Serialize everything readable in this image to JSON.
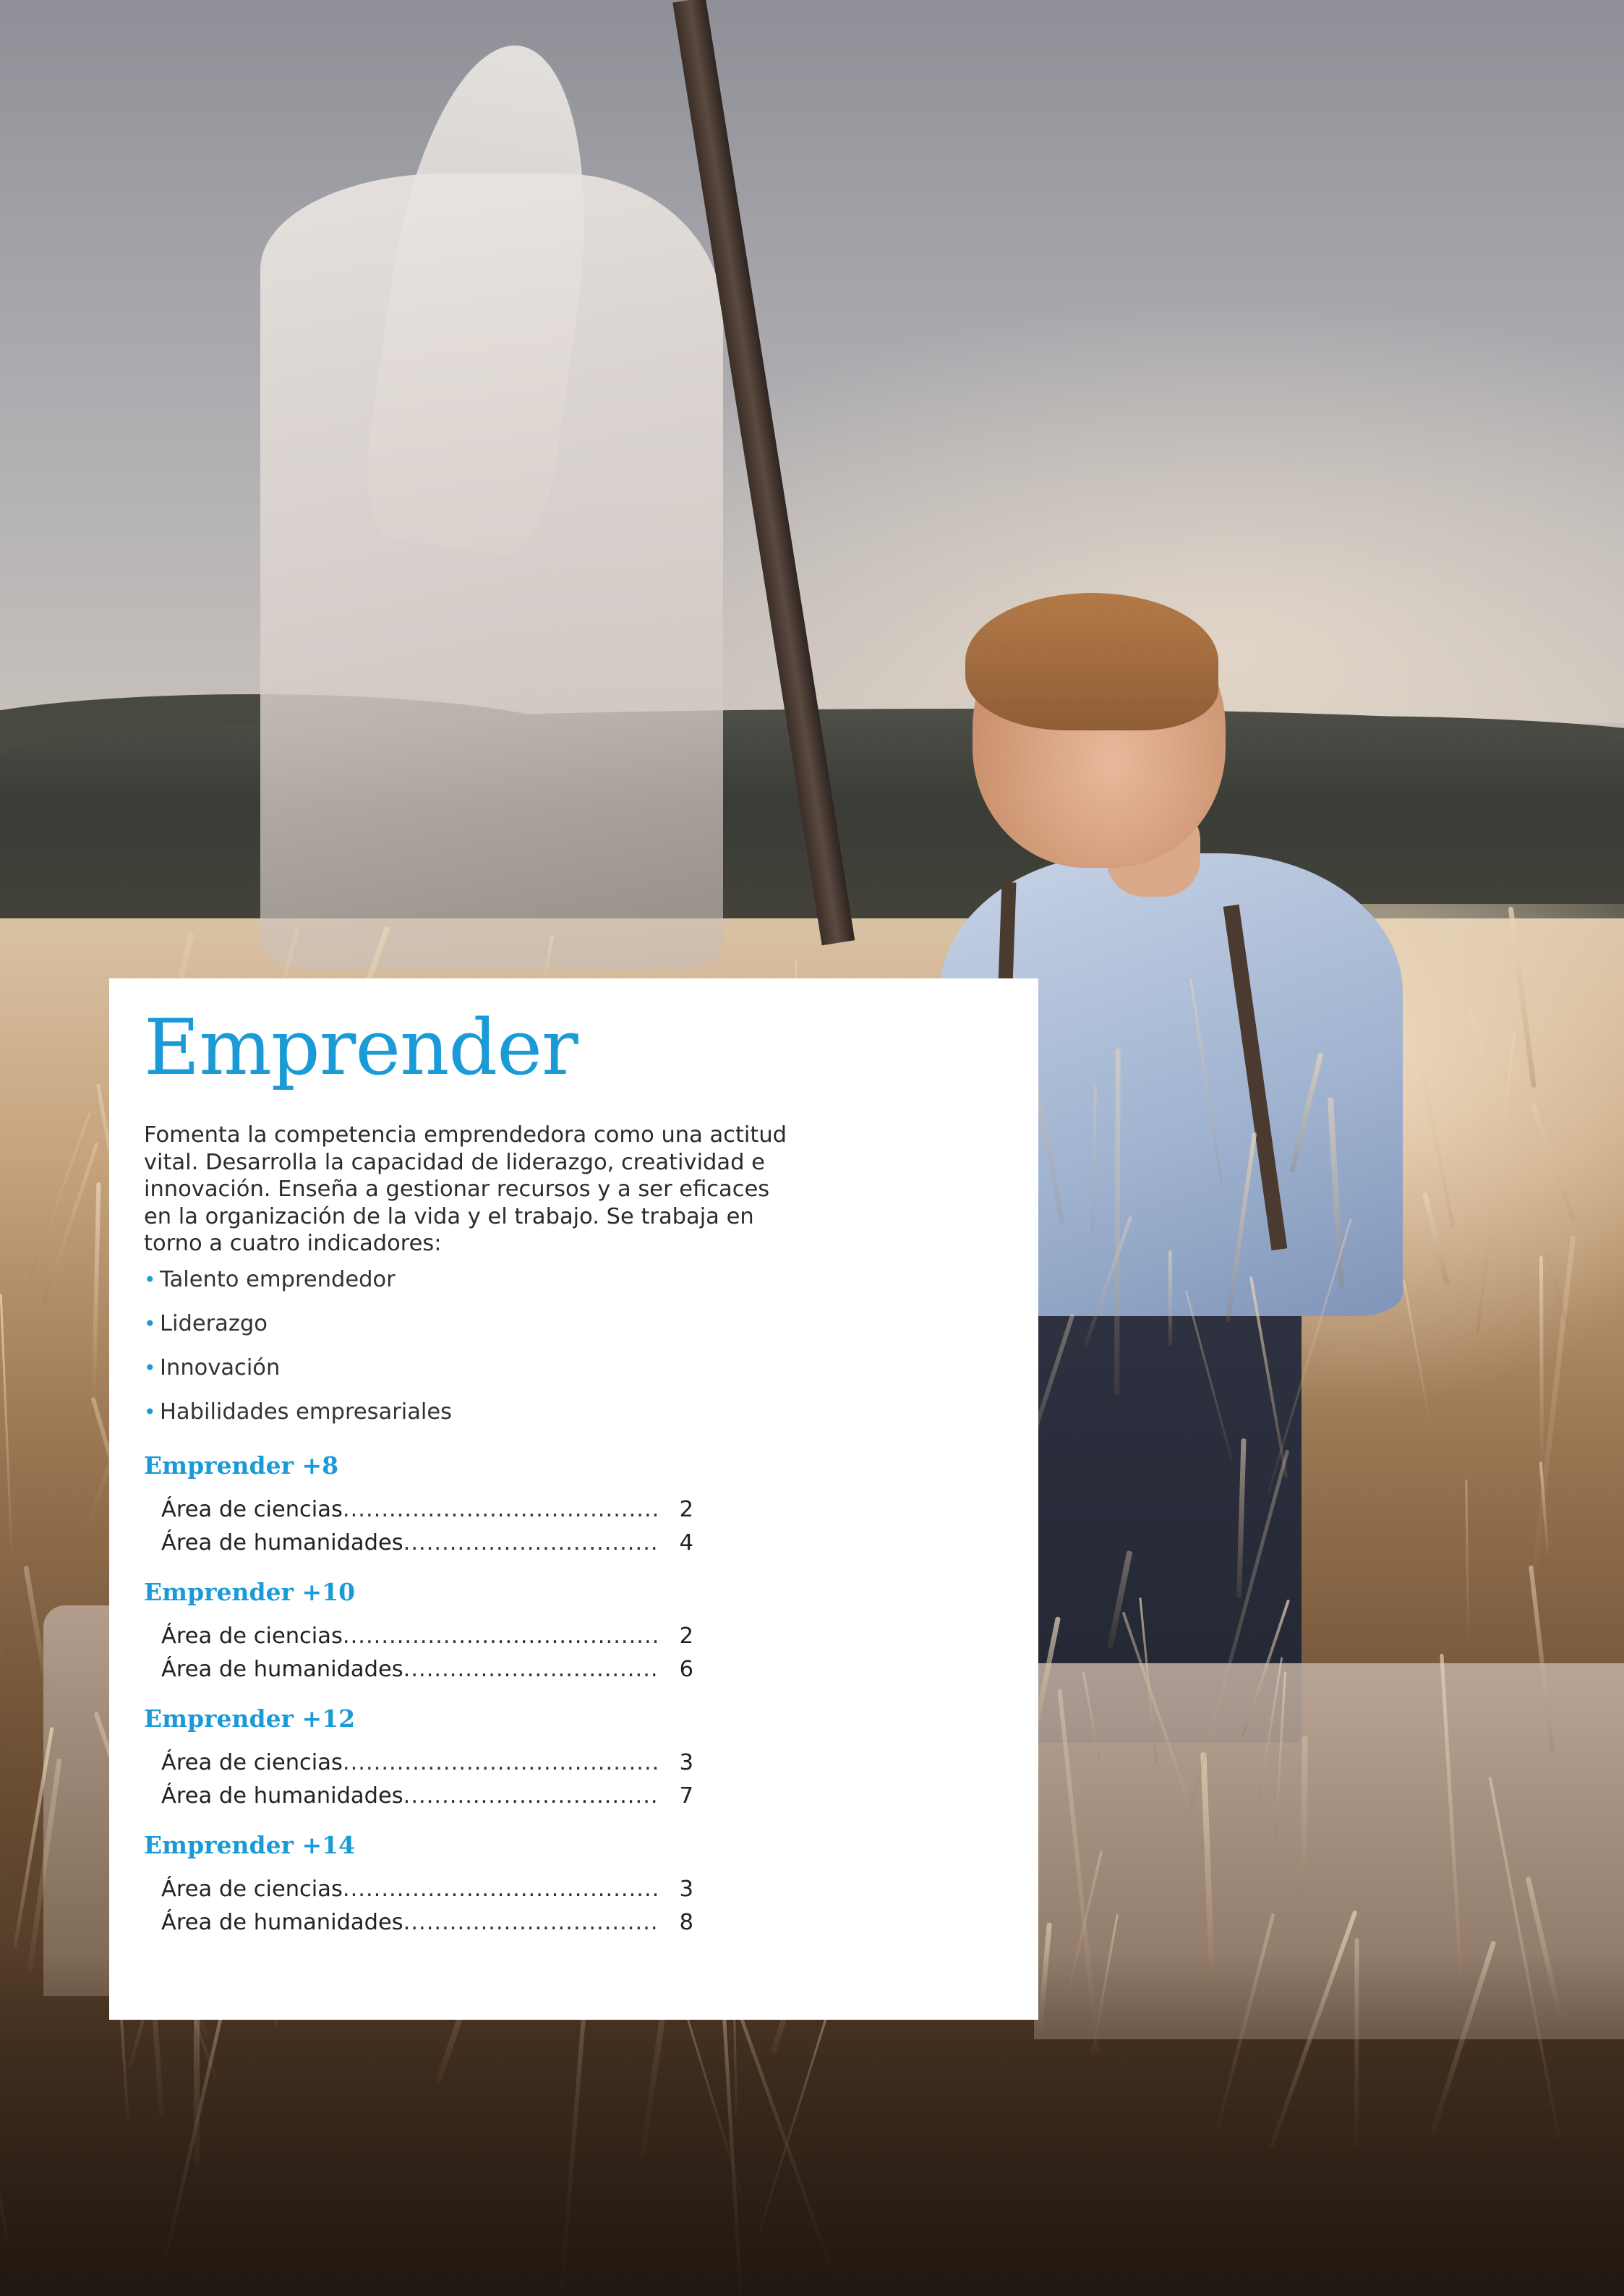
{
  "title": "Emprender",
  "intro": "Fomenta la competencia emprendedora como una actitud vital. Desarrolla la capacidad de liderazgo, creatividad e innovación. Enseña a gestionar recursos y a ser eficaces en la organización de la vida y el trabajo. Se trabaja en torno a cuatro indicadores:",
  "bullet_marker": "•",
  "indicators": [
    "Talento emprendedor",
    "Liderazgo",
    "Innovación",
    "Habilidades empresariales"
  ],
  "toc": [
    {
      "heading": "Emprender +8",
      "entries": [
        {
          "label": "Área de ciencias",
          "page": "2"
        },
        {
          "label": "Área de humanidades",
          "page": "4"
        }
      ]
    },
    {
      "heading": "Emprender +10",
      "entries": [
        {
          "label": "Área de ciencias",
          "page": "2"
        },
        {
          "label": "Área de humanidades",
          "page": "6"
        }
      ]
    },
    {
      "heading": "Emprender +12",
      "entries": [
        {
          "label": "Área de ciencias",
          "page": "3"
        },
        {
          "label": "Área de humanidades",
          "page": "7"
        }
      ]
    },
    {
      "heading": "Emprender +14",
      "entries": [
        {
          "label": "Área de ciencias",
          "page": "3"
        },
        {
          "label": "Área de humanidades",
          "page": "8"
        }
      ]
    }
  ],
  "colors": {
    "accent": "#1a9ad6",
    "text": "#2b2b2b",
    "panel": "#ffffff"
  }
}
